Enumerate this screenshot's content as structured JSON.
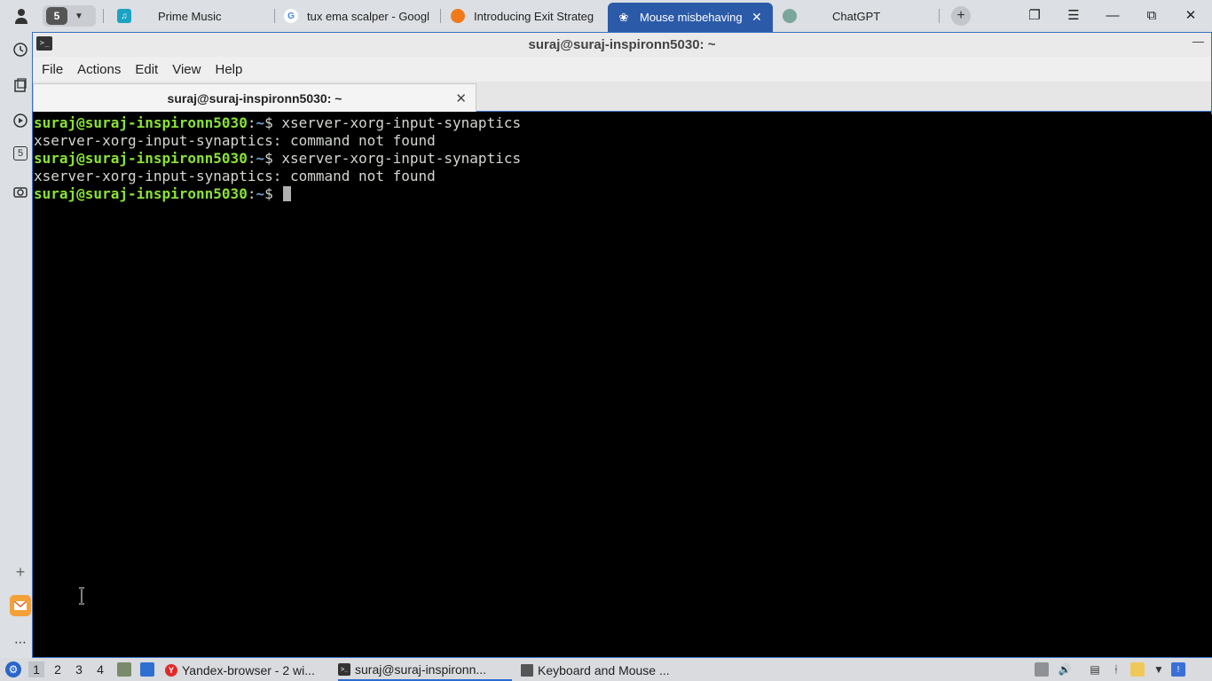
{
  "browser": {
    "tab_count": "5",
    "tabs": [
      {
        "title": "Prime Music"
      },
      {
        "title": "tux ema scalper - Googl"
      },
      {
        "title": "Introducing Exit Strateg"
      },
      {
        "title": "Mouse misbehaving i"
      },
      {
        "title": "ChatGPT"
      }
    ],
    "new_tab_label": "+"
  },
  "sidebar": {
    "badge": "5"
  },
  "terminal": {
    "window_title": "suraj@suraj-inspironn5030: ~",
    "menu": [
      "File",
      "Actions",
      "Edit",
      "View",
      "Help"
    ],
    "tab_label": "suraj@suraj-inspironn5030: ~",
    "user_host": "suraj@suraj-inspironn5030",
    "sep": ":",
    "path": "~",
    "prompt_char": "$ ",
    "lines": [
      {
        "type": "cmd",
        "text": "xserver-xorg-input-synaptics"
      },
      {
        "type": "out",
        "text": "xserver-xorg-input-synaptics: command not found"
      },
      {
        "type": "cmd",
        "text": "xserver-xorg-input-synaptics"
      },
      {
        "type": "out",
        "text": "xserver-xorg-input-synaptics: command not found"
      },
      {
        "type": "prompt",
        "text": ""
      }
    ]
  },
  "taskbar": {
    "workspaces": [
      "1",
      "2",
      "3",
      "4"
    ],
    "tasks": [
      {
        "label": "Yandex-browser - 2 wi..."
      },
      {
        "label": "suraj@suraj-inspironn..."
      },
      {
        "label": "Keyboard and Mouse ..."
      }
    ]
  },
  "colors": {
    "prompt_user": "#8ae234",
    "prompt_path": "#729fcf",
    "active_tab": "#2b5aa8",
    "terminal_bg": "#000000"
  }
}
